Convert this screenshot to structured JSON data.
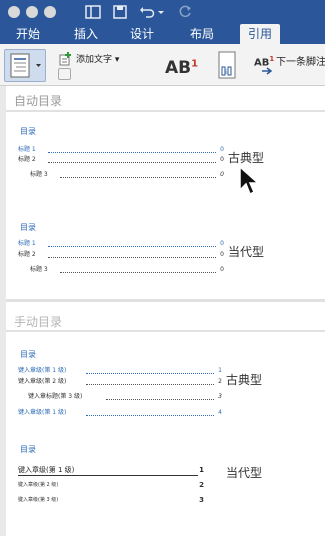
{
  "ribbon_tabs": [
    "开始",
    "插入",
    "设计",
    "布局",
    "引用"
  ],
  "ribbon": {
    "add_text": "添加文字",
    "add_text_arrow": "▾",
    "insert_footnote_label": "AB",
    "insert_footnote_sup": "1",
    "next_footnote_label": "AB",
    "next_footnote_sup": "1",
    "next_footnote": "下一条脚注"
  },
  "automatic": {
    "header": "自动目录",
    "classic": {
      "style_name": "古典型",
      "toc_title": "目录",
      "entries": [
        {
          "text": "标题 1",
          "page": "0"
        },
        {
          "text": "标题 2",
          "page": "0"
        },
        {
          "text": "标题 3",
          "page": "0"
        }
      ]
    },
    "contemporary": {
      "style_name": "当代型",
      "toc_title": "目录",
      "entries": [
        {
          "text": "标题 1",
          "page": "0"
        },
        {
          "text": "标题 2",
          "page": "0"
        },
        {
          "text": "标题 3",
          "page": "0"
        }
      ]
    }
  },
  "manual": {
    "header": "手动目录",
    "classic": {
      "style_name": "古典型",
      "toc_title": "目录",
      "entries": [
        {
          "text": "键入章级(第 1 级)",
          "page": "1"
        },
        {
          "text": "键入章级(第 2 级)",
          "page": "2"
        },
        {
          "text": "键入章标题(第 3 级)",
          "page": "3"
        },
        {
          "text": "键入章级(第 1 级)",
          "page": "4"
        }
      ]
    },
    "contemporary": {
      "style_name": "当代型",
      "toc_title": "目录",
      "entries": [
        {
          "text": "键入章级(第 1 级)",
          "page": "1"
        },
        {
          "text": "键入章级(第 2 级)",
          "page": "2"
        },
        {
          "text": "键入章级(第 3 级)",
          "page": "3"
        }
      ]
    }
  },
  "colors": {
    "accent": "#2b579a",
    "toc_blue": "#2e6bb8",
    "heading_gray": "#9a9a9a"
  }
}
